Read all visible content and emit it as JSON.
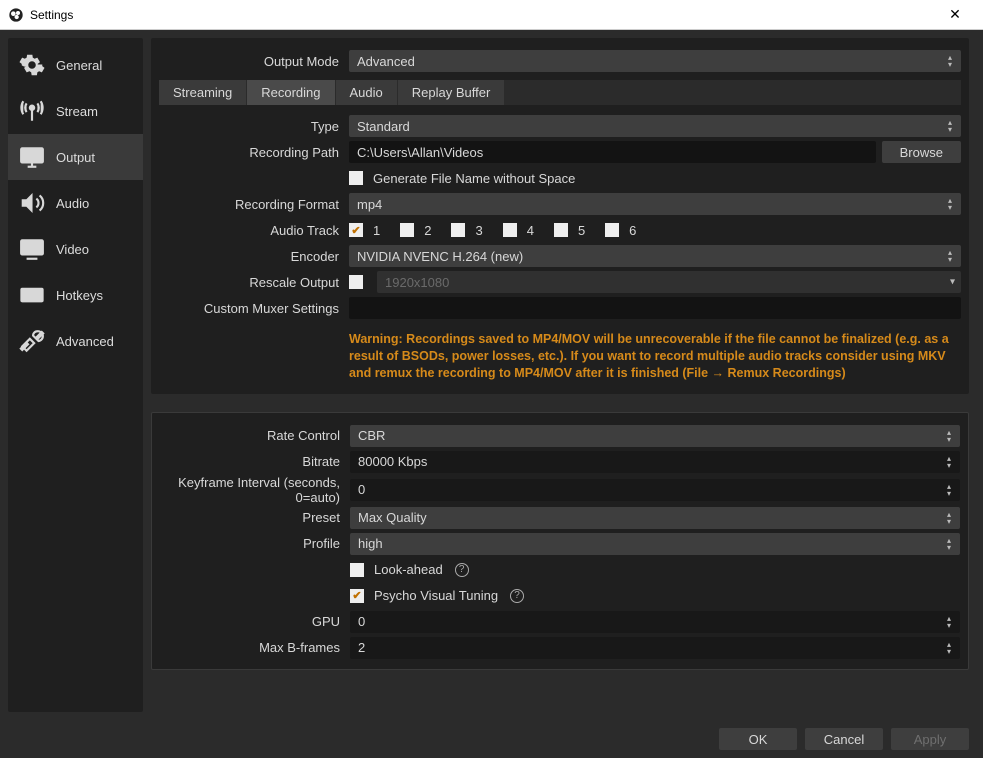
{
  "window": {
    "title": "Settings"
  },
  "sidebar": {
    "items": [
      {
        "label": "General"
      },
      {
        "label": "Stream"
      },
      {
        "label": "Output"
      },
      {
        "label": "Audio"
      },
      {
        "label": "Video"
      },
      {
        "label": "Hotkeys"
      },
      {
        "label": "Advanced"
      }
    ]
  },
  "output_mode": {
    "label": "Output Mode",
    "value": "Advanced"
  },
  "tabs": [
    {
      "label": "Streaming"
    },
    {
      "label": "Recording"
    },
    {
      "label": "Audio"
    },
    {
      "label": "Replay Buffer"
    }
  ],
  "rec": {
    "type_label": "Type",
    "type_value": "Standard",
    "path_label": "Recording Path",
    "path_value": "C:\\Users\\Allan\\Videos",
    "browse": "Browse",
    "gen_label": "Generate File Name without Space",
    "fmt_label": "Recording Format",
    "fmt_value": "mp4",
    "track_label": "Audio Track",
    "tracks": [
      "1",
      "2",
      "3",
      "4",
      "5",
      "6"
    ],
    "enc_label": "Encoder",
    "enc_value": "NVIDIA NVENC H.264 (new)",
    "rescale_label": "Rescale Output",
    "rescale_value": "1920x1080",
    "muxer_label": "Custom Muxer Settings",
    "warning": "Warning: Recordings saved to MP4/MOV will be unrecoverable if the file cannot be finalized (e.g. as a result of BSODs, power losses, etc.). If you want to record multiple audio tracks consider using MKV and remux the recording to MP4/MOV after it is finished (File → Remux Recordings)"
  },
  "enc": {
    "rc_label": "Rate Control",
    "rc_value": "CBR",
    "bitrate_label": "Bitrate",
    "bitrate_value": "80000 Kbps",
    "keyint_label": "Keyframe Interval (seconds, 0=auto)",
    "keyint_value": "0",
    "preset_label": "Preset",
    "preset_value": "Max Quality",
    "profile_label": "Profile",
    "profile_value": "high",
    "lookahead_label": "Look-ahead",
    "psycho_label": "Psycho Visual Tuning",
    "gpu_label": "GPU",
    "gpu_value": "0",
    "bframes_label": "Max B-frames",
    "bframes_value": "2"
  },
  "footer": {
    "ok": "OK",
    "cancel": "Cancel",
    "apply": "Apply"
  }
}
